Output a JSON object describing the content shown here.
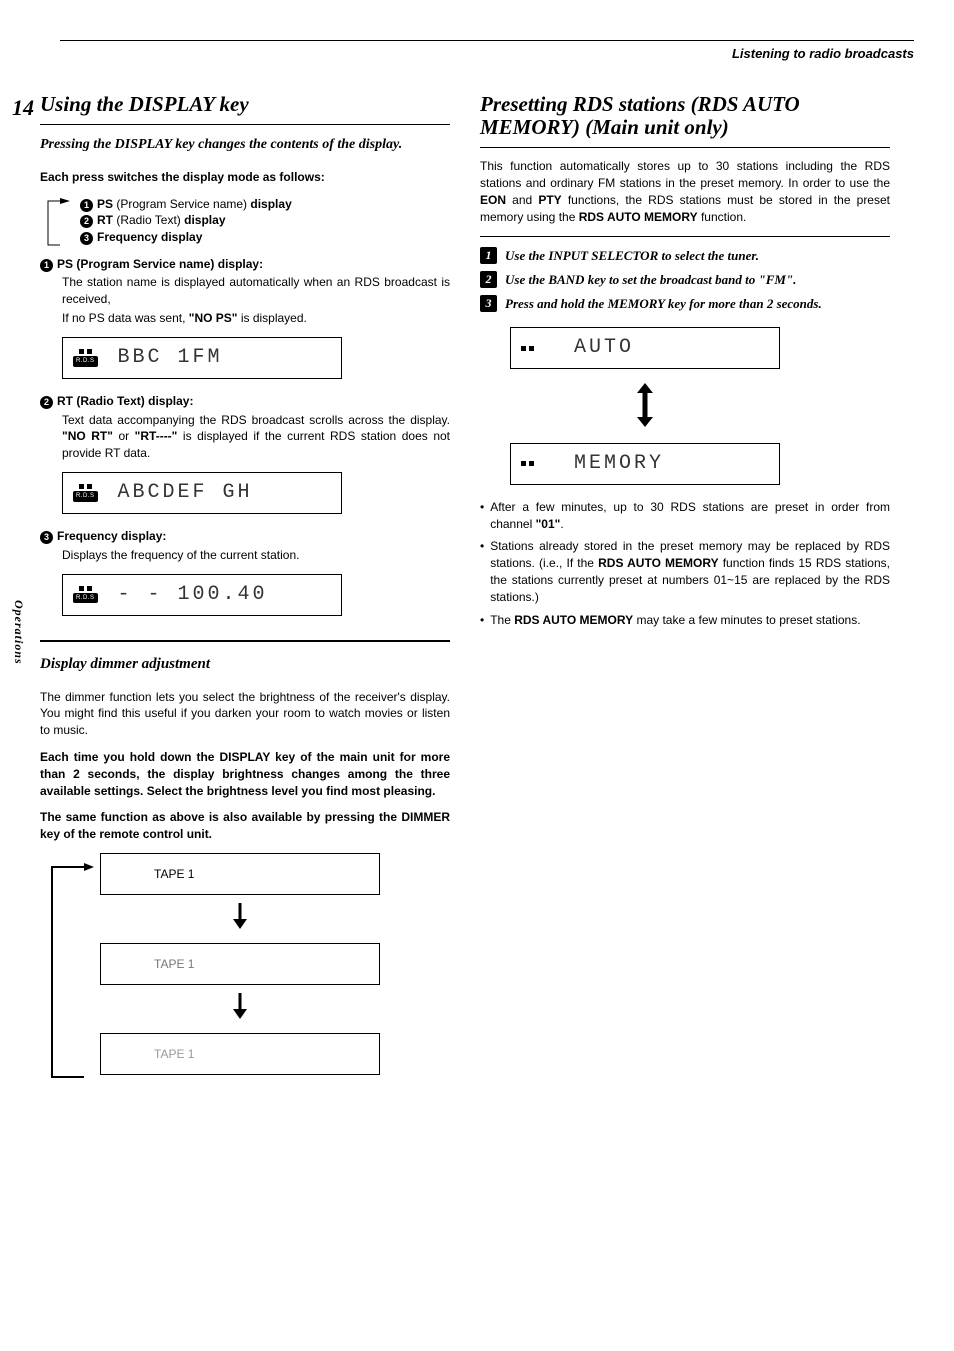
{
  "header": {
    "breadcrumb": "Listening to radio broadcasts"
  },
  "page_number": "14",
  "side_tab": "Operations",
  "left": {
    "title": "Using the DISPLAY key",
    "subtitle": "Pressing the DISPLAY key changes the contents of the display.",
    "switch_intro": "Each press switches the display mode as follows:",
    "modes": {
      "m1_label": "PS",
      "m1_desc": " (Program Service name) ",
      "m1_suffix": "display",
      "m2_label": "RT",
      "m2_desc": " (Radio Text) ",
      "m2_suffix": "display",
      "m3_label": "Frequency display"
    },
    "ps": {
      "heading": "PS (Program Service name) display:",
      "body1": "The station name is displayed automatically when an RDS broadcast is received,",
      "body2_a": "If no PS data was sent, ",
      "body2_b": "\"NO PS\"",
      "body2_c": " is displayed.",
      "lcd": "BBC  1FM",
      "rds": "R.D.S"
    },
    "rt": {
      "heading": "RT (Radio Text) display:",
      "body_a": "Text data accompanying the RDS broadcast scrolls across the display. ",
      "body_b": "\"NO RT\"",
      "body_c": " or ",
      "body_d": "\"RT----\"",
      "body_e": " is displayed if the current RDS station does not provide RT data.",
      "lcd": "ABCDEF GH",
      "rds": "R.D.S"
    },
    "freq": {
      "heading": "Frequency display:",
      "body": "Displays the frequency of the current station.",
      "lcd": "- -   100.40",
      "rds": "R.D.S"
    },
    "dimmer": {
      "title": "Display dimmer adjustment",
      "p1": "The dimmer function lets you select the brightness of the receiver's display. You might find this useful if you darken your room to watch movies or listen to music.",
      "p2": "Each time you hold down the DISPLAY key of the main unit for more than 2 seconds, the display brightness changes among the three available settings. Select the brightness level you find most pleasing.",
      "p3": "The same function as above is also available by pressing the DIMMER key of the remote control unit.",
      "lcd1": "TAPE 1",
      "lcd2": "TAPE 1",
      "lcd3": "TAPE 1"
    }
  },
  "right": {
    "title": "Presetting RDS stations (RDS AUTO MEMORY) (Main unit only)",
    "intro_a": "This function automatically stores up to 30 stations including the RDS stations and ordinary FM stations in the preset memory. In order to use the ",
    "intro_b": "EON",
    "intro_c": " and ",
    "intro_d": "PTY",
    "intro_e": " functions, the RDS stations must be stored in the preset memory using the ",
    "intro_f": "RDS AUTO MEMORY",
    "intro_g": " function.",
    "steps": {
      "s1": "Use the INPUT SELECTOR to select the tuner.",
      "s2": "Use the BAND key to set the broadcast band to \"FM\".",
      "s3": "Press and hold the MEMORY key for more than 2 seconds."
    },
    "lcd1": "AUTO",
    "lcd2": "MEMORY",
    "bullets": {
      "b1_a": "After a few minutes, up to 30 RDS stations are preset in order from channel ",
      "b1_b": "\"01\"",
      "b1_c": ".",
      "b2_a": "Stations already stored in the preset memory may be replaced by RDS stations. (i.e., If the ",
      "b2_b": "RDS AUTO MEMORY",
      "b2_c": " function finds 15 RDS stations, the stations currently preset at numbers 01~15 are replaced by the RDS stations.)",
      "b3_a": "The ",
      "b3_b": "RDS AUTO MEMORY",
      "b3_c": " may take a few minutes to preset stations."
    }
  }
}
